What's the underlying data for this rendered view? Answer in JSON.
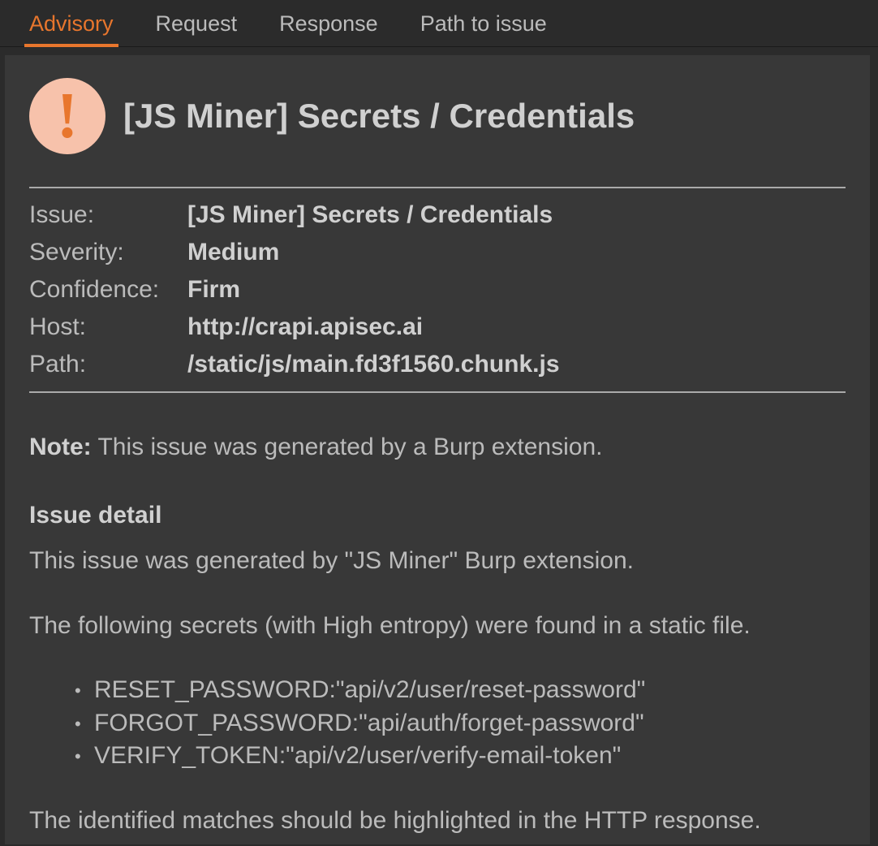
{
  "tabs": {
    "advisory": "Advisory",
    "request": "Request",
    "response": "Response",
    "path_to_issue": "Path to issue"
  },
  "issue": {
    "title": "[JS Miner] Secrets / Credentials",
    "meta": {
      "issue_label": "Issue:",
      "issue_value": "[JS Miner] Secrets / Credentials",
      "severity_label": "Severity:",
      "severity_value": "Medium",
      "confidence_label": "Confidence:",
      "confidence_value": "Firm",
      "host_label": "Host:",
      "host_value": "http://crapi.apisec.ai",
      "path_label": "Path:",
      "path_value": "/static/js/main.fd3f1560.chunk.js"
    },
    "note_label": "Note:",
    "note_text": " This issue was generated by a Burp extension.",
    "detail_heading": "Issue detail",
    "detail_intro": "This issue was generated by \"JS Miner\" Burp extension.",
    "secrets_intro": "The following secrets (with High entropy) were found in a static file.",
    "secrets": [
      "RESET_PASSWORD:\"api/v2/user/reset-password\"",
      "FORGOT_PASSWORD:\"api/auth/forget-password\"",
      "VERIFY_TOKEN:\"api/v2/user/verify-email-token\""
    ],
    "closing": "The identified matches should be highlighted in the HTTP response."
  }
}
